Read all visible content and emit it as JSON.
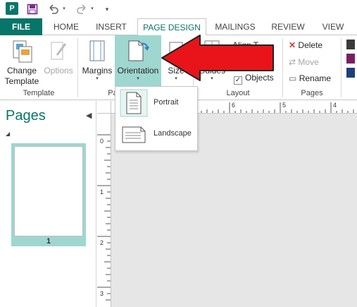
{
  "qat": {
    "app_icon": "P",
    "icons": [
      "publisher-app-icon",
      "save-icon",
      "undo-icon",
      "redo-icon",
      "customize-qat-icon"
    ]
  },
  "tabs": {
    "file": "FILE",
    "home": "HOME",
    "insert": "INSERT",
    "page_design": "PAGE DESIGN",
    "mailings": "MAILINGS",
    "review": "REVIEW",
    "view": "VIEW",
    "active": "PAGE DESIGN"
  },
  "ribbon": {
    "template_group": {
      "label": "Template",
      "change_template_line1": "Change",
      "change_template_line2": "Template",
      "options": "Options"
    },
    "page_setup_group": {
      "label_partial": "Pa",
      "margins": "Margins",
      "orientation": "Orientation",
      "size": "Size"
    },
    "layout_group": {
      "label": "Layout",
      "guides": "Guides",
      "align_to_partial": "Align T",
      "guides_check": "Guides",
      "objects_check": "Objects",
      "guides_checked": true,
      "objects_checked": true
    },
    "pages_group": {
      "label": "Pages",
      "delete": "Delete",
      "move": "Move",
      "rename": "Rename"
    }
  },
  "pages_panel": {
    "title": "Pages",
    "collapse_icon": "chevron-left-icon",
    "page_number": "1"
  },
  "rulers": {
    "horizontal_ticks": [
      "6",
      "5",
      "4"
    ],
    "vertical_ticks": [
      "0",
      "1",
      "2",
      "3"
    ]
  },
  "orientation_menu": {
    "items": [
      {
        "label": "Portrait",
        "icon": "portrait-page-icon"
      },
      {
        "label": "Landscape",
        "icon": "landscape-page-icon"
      }
    ]
  },
  "colors": {
    "accent": "#077568",
    "selection": "#9fd6d0",
    "arrow": "#e8141a"
  }
}
